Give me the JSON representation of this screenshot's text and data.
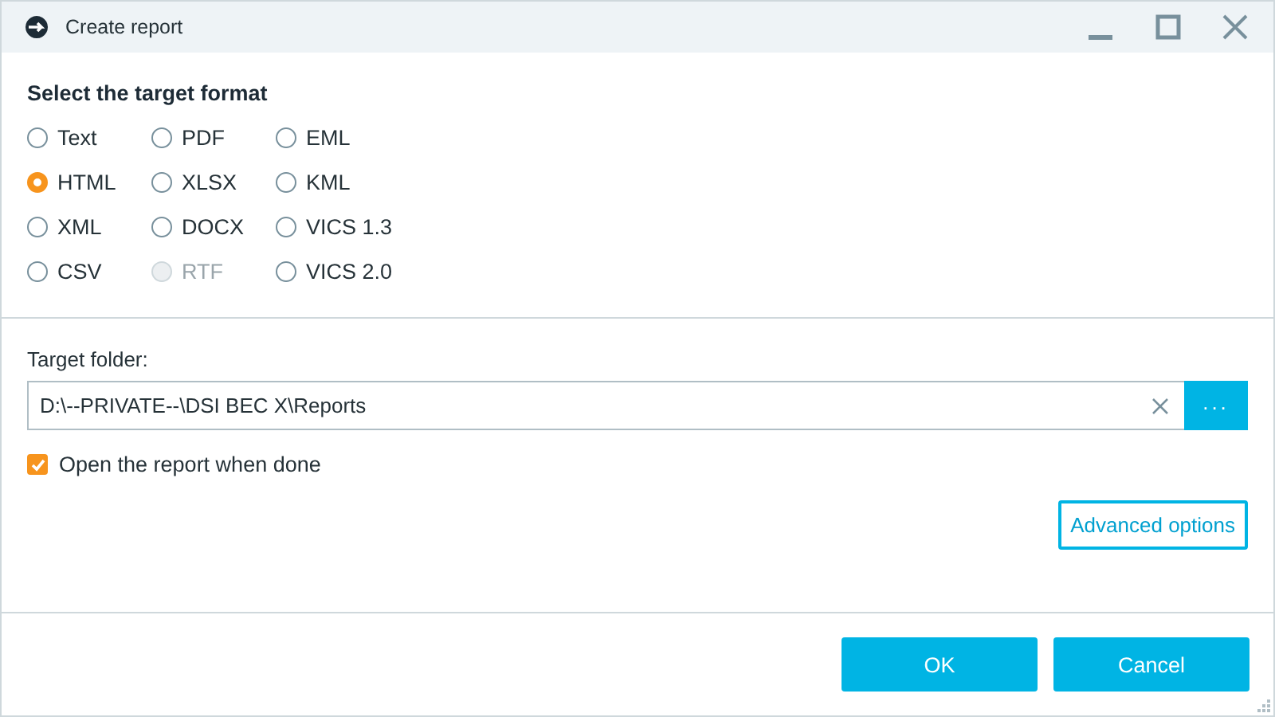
{
  "window": {
    "title": "Create report"
  },
  "format_section": {
    "heading": "Select the target format",
    "options": [
      {
        "label": "Text",
        "selected": false,
        "disabled": false
      },
      {
        "label": "PDF",
        "selected": false,
        "disabled": false
      },
      {
        "label": "EML",
        "selected": false,
        "disabled": false
      },
      {
        "label": "HTML",
        "selected": true,
        "disabled": false
      },
      {
        "label": "XLSX",
        "selected": false,
        "disabled": false
      },
      {
        "label": "KML",
        "selected": false,
        "disabled": false
      },
      {
        "label": "XML",
        "selected": false,
        "disabled": false
      },
      {
        "label": "DOCX",
        "selected": false,
        "disabled": false
      },
      {
        "label": "VICS 1.3",
        "selected": false,
        "disabled": false
      },
      {
        "label": "CSV",
        "selected": false,
        "disabled": false
      },
      {
        "label": "RTF",
        "selected": false,
        "disabled": true
      },
      {
        "label": "VICS 2.0",
        "selected": false,
        "disabled": false
      }
    ]
  },
  "target_folder": {
    "label": "Target folder:",
    "value": "D:\\--PRIVATE--\\DSI BEC X\\Reports",
    "browse_button": "..."
  },
  "open_when_done": {
    "label": "Open the report when done",
    "checked": true
  },
  "advanced_button": "Advanced options",
  "buttons": [
    "OK",
    "Cancel"
  ]
}
